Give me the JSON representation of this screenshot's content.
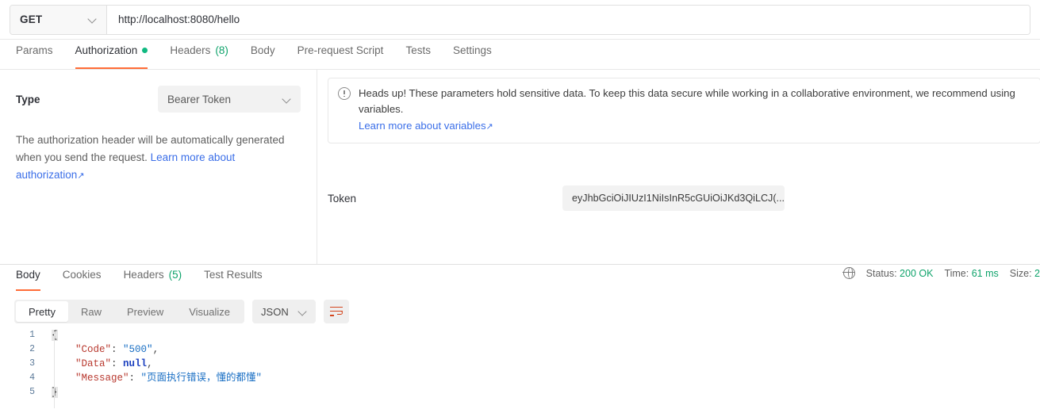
{
  "request": {
    "method": "GET",
    "url": "http://localhost:8080/hello",
    "method_caret_icon": "chevron-down-icon",
    "tabs": [
      {
        "label": "Params",
        "active": false,
        "badge": "",
        "dot": false
      },
      {
        "label": "Authorization",
        "active": true,
        "badge": "",
        "dot": true
      },
      {
        "label": "Headers",
        "active": false,
        "badge": "(8)",
        "dot": false
      },
      {
        "label": "Body",
        "active": false,
        "badge": "",
        "dot": false
      },
      {
        "label": "Pre-request Script",
        "active": false,
        "badge": "",
        "dot": false
      },
      {
        "label": "Tests",
        "active": false,
        "badge": "",
        "dot": false
      },
      {
        "label": "Settings",
        "active": false,
        "badge": "",
        "dot": false
      }
    ]
  },
  "authorization": {
    "type_label": "Type",
    "type_value": "Bearer Token",
    "type_caret_icon": "chevron-down-icon",
    "helper_text": "The authorization header will be automatically generated when you send the request.",
    "helper_link": "Learn more about authorization",
    "helper_link_arrow": "↗",
    "token_label": "Token",
    "token_value": "eyJhbGciOiJIUzI1NiIsInR5cGUiOiJKd3QiLCJ(...",
    "token_placeholder": "Token"
  },
  "banner": {
    "icon": "info-circle-icon",
    "text": "Heads up! These parameters hold sensitive data. To keep this data secure while working in a collaborative environment, we recommend using variables.",
    "link": "Learn more about variables",
    "link_arrow": "↗"
  },
  "response": {
    "tabs": [
      {
        "label": "Body",
        "active": true,
        "badge": ""
      },
      {
        "label": "Cookies",
        "active": false,
        "badge": ""
      },
      {
        "label": "Headers",
        "active": false,
        "badge": "(5)"
      },
      {
        "label": "Test Results",
        "active": false,
        "badge": ""
      }
    ],
    "status_icon": "globe-icon",
    "status_label": "Status:",
    "status_value": "200 OK",
    "time_label": "Time:",
    "time_value": "61 ms",
    "size_label": "Size:",
    "size_value": "2",
    "format_tabs": [
      {
        "label": "Pretty",
        "active": true
      },
      {
        "label": "Raw",
        "active": false
      },
      {
        "label": "Preview",
        "active": false
      },
      {
        "label": "Visualize",
        "active": false
      }
    ],
    "language": "JSON",
    "language_caret_icon": "chevron-down-icon",
    "wrap_icon": "word-wrap-icon",
    "body_lines": [
      {
        "no": "1",
        "indent": "",
        "brace_open": "{",
        "key": "",
        "colon": "",
        "value": "",
        "comma": "",
        "type": "brace"
      },
      {
        "no": "2",
        "indent": "    ",
        "key": "\"Code\"",
        "colon": ": ",
        "value": "\"500\"",
        "comma": ",",
        "type": "string"
      },
      {
        "no": "3",
        "indent": "    ",
        "key": "\"Data\"",
        "colon": ": ",
        "value": "null",
        "comma": ",",
        "type": "null"
      },
      {
        "no": "4",
        "indent": "    ",
        "key": "\"Message\"",
        "colon": ": ",
        "value": "\"页面执行错误，懂的都懂\"",
        "comma": "",
        "type": "string"
      },
      {
        "no": "5",
        "indent": "",
        "brace_close": "}",
        "key": "",
        "colon": "",
        "value": "",
        "comma": "",
        "type": "brace"
      }
    ]
  },
  "colors": {
    "accent": "#ff6c37",
    "success": "#0fa36b",
    "link": "#3a6ee8",
    "json_key": "#b8392f",
    "json_string": "#1a6fc4",
    "json_null": "#1a3fbf",
    "dot_green": "#10b981"
  }
}
